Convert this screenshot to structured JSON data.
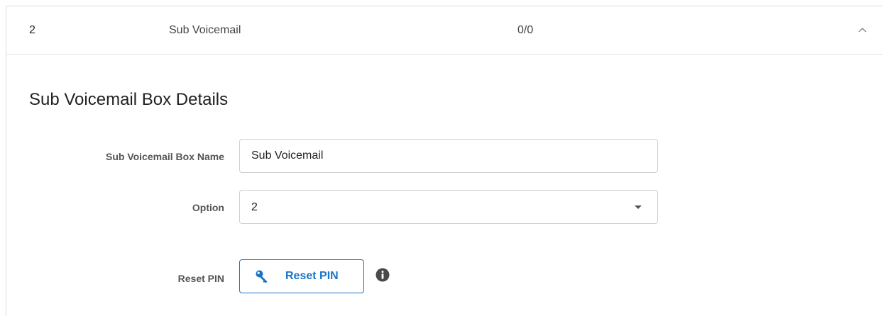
{
  "header_row": {
    "number": "2",
    "name": "Sub Voicemail",
    "count": "0/0"
  },
  "section": {
    "title": "Sub Voicemail Box Details"
  },
  "form": {
    "name_label": "Sub Voicemail Box Name",
    "name_value": "Sub Voicemail",
    "option_label": "Option",
    "option_value": "2",
    "reset_label": "Reset PIN",
    "reset_button_label": "Reset PIN"
  },
  "icons": {
    "collapse": "chevron-up-icon",
    "dropdown": "caret-down-icon",
    "reset": "key-icon",
    "info": "info-icon"
  },
  "colors": {
    "accent": "#1a73c8",
    "border": "#cfcfcf",
    "label": "#555555"
  }
}
